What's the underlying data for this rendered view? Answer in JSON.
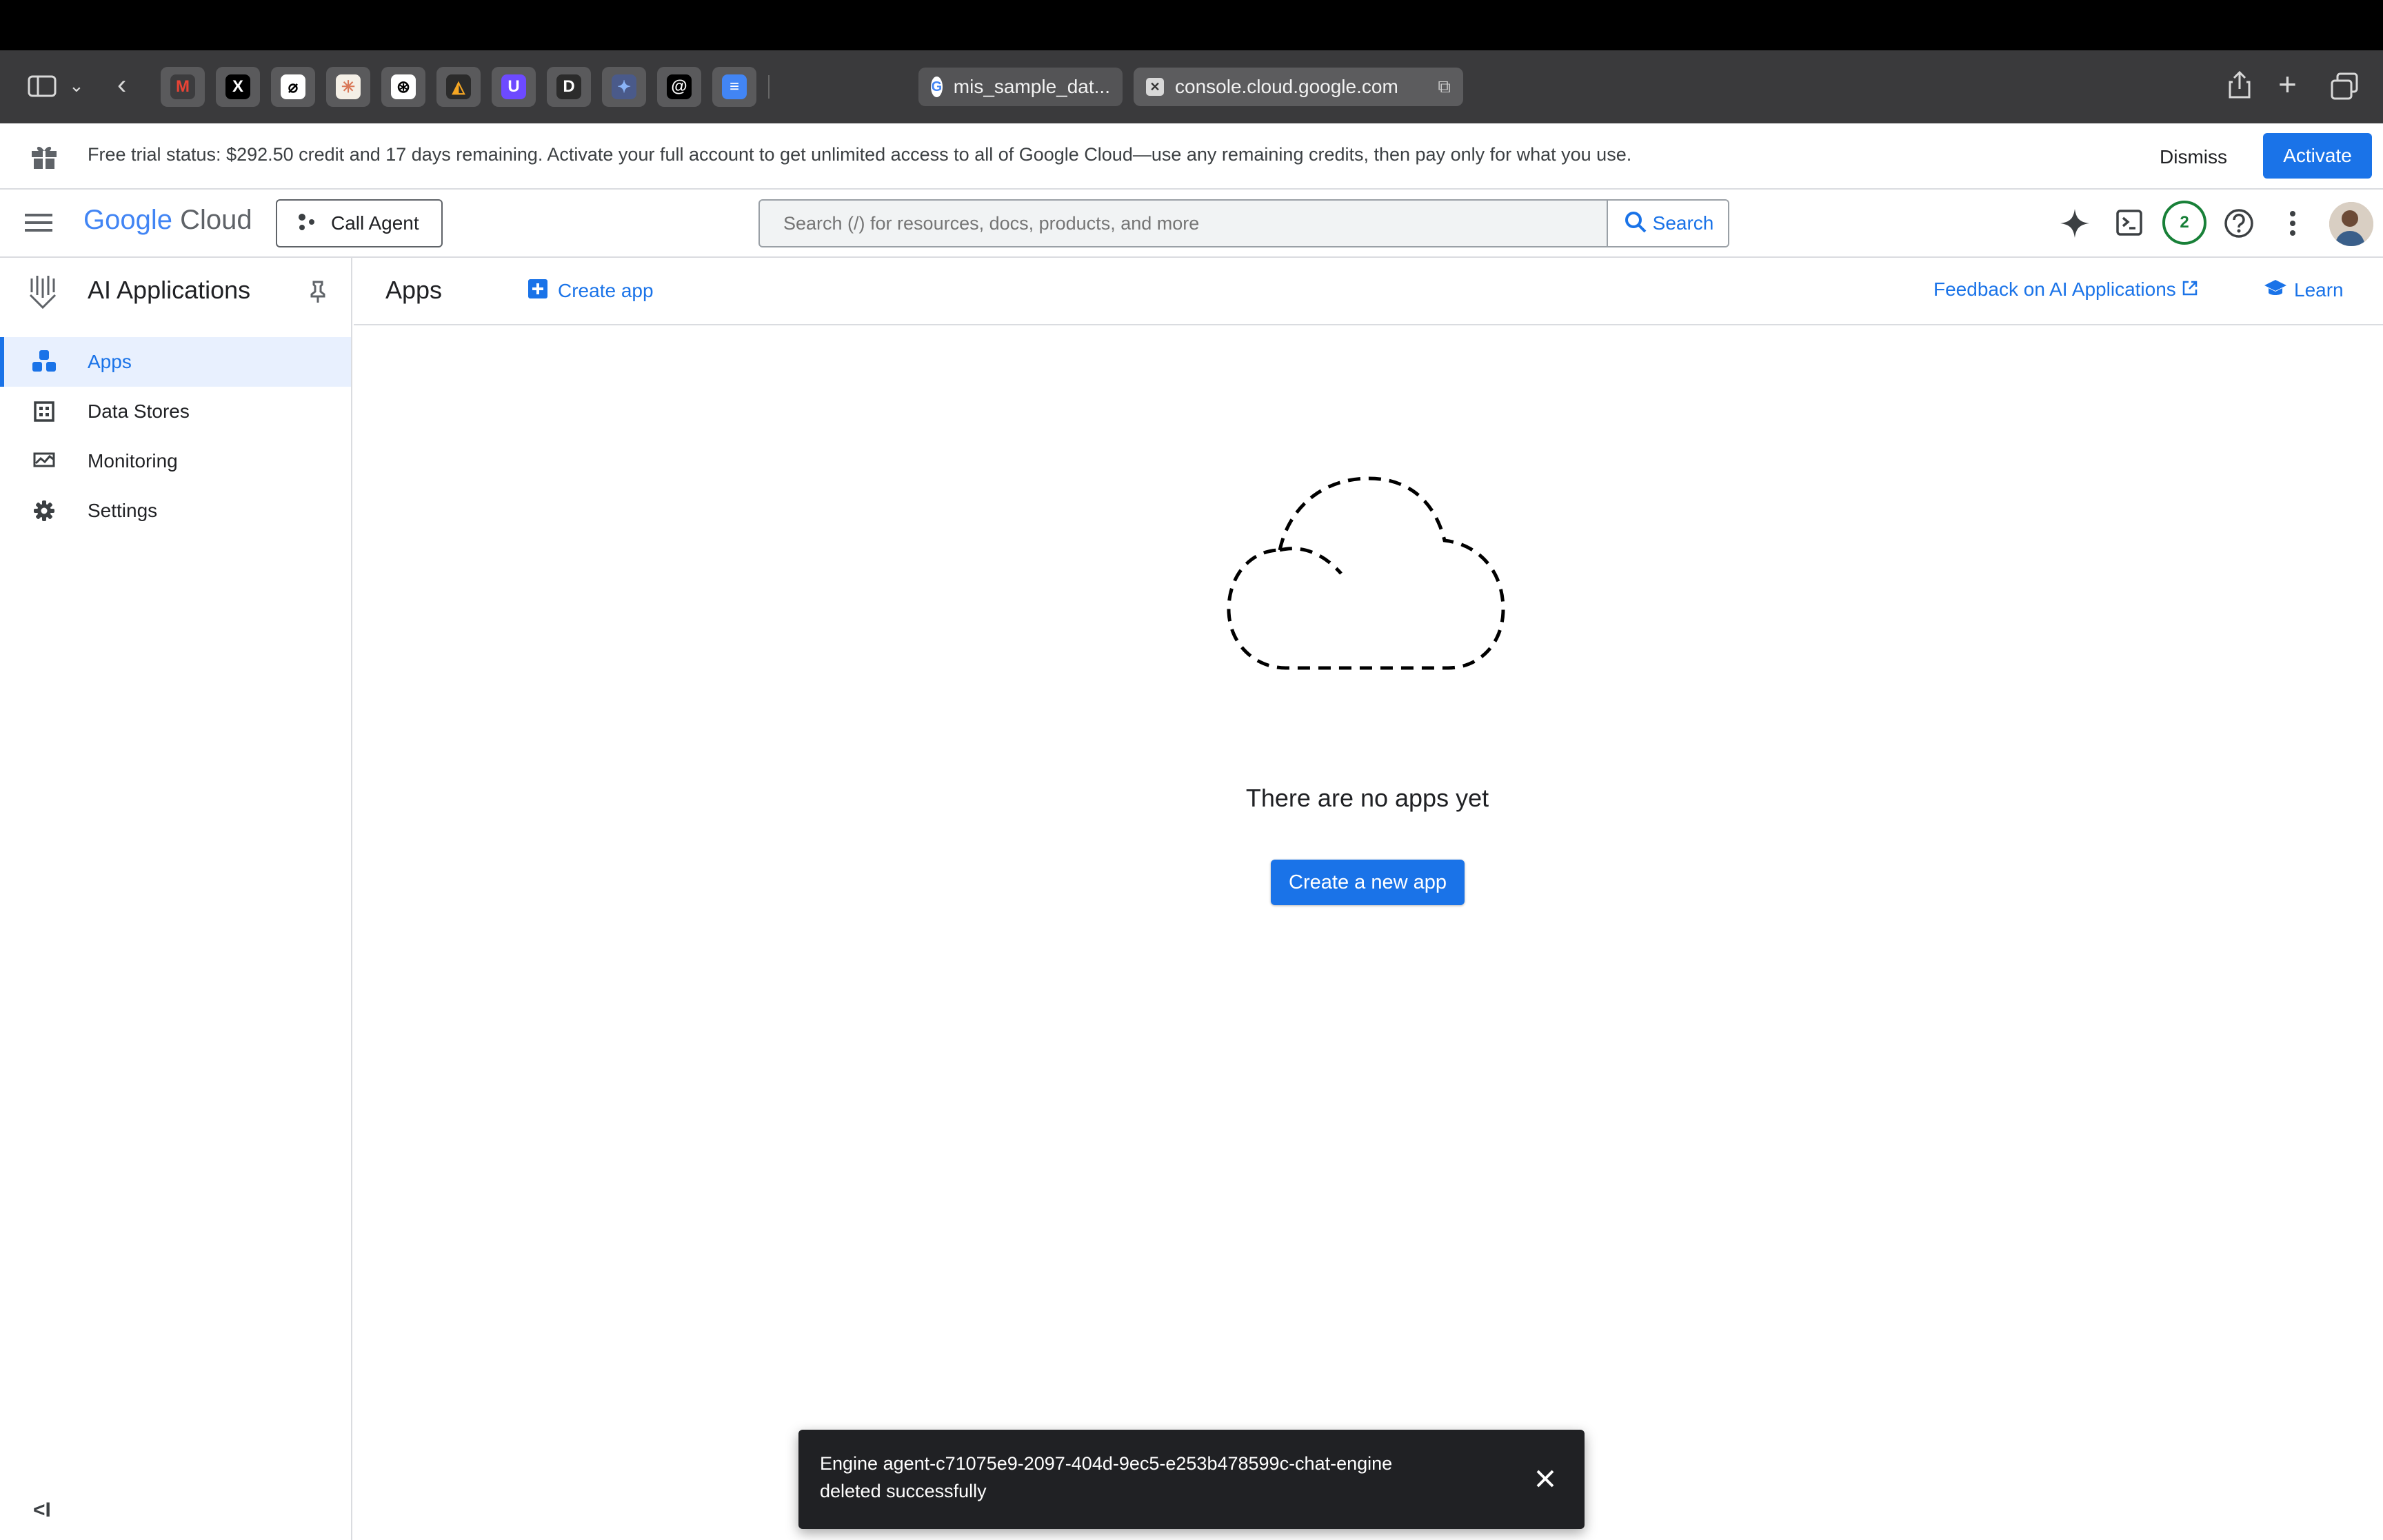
{
  "browser": {
    "tabs": [
      {
        "title": "mis_sample_dat...",
        "favicon": "google-g-icon"
      },
      {
        "title": "console.cloud.google.com",
        "favicon": "close-icon"
      }
    ],
    "favorites": [
      {
        "name": "gmail-favicon",
        "bg": "#3c3c3e",
        "glyph": "M",
        "color": "#ea4335"
      },
      {
        "name": "x-favicon",
        "bg": "#000000",
        "glyph": "X",
        "color": "#ffffff"
      },
      {
        "name": "perplexity-favicon",
        "bg": "#ffffff",
        "glyph": "⌀",
        "color": "#000000"
      },
      {
        "name": "claude-favicon",
        "bg": "#f4efe6",
        "glyph": "✳",
        "color": "#d97757"
      },
      {
        "name": "openai-favicon",
        "bg": "#ffffff",
        "glyph": "⊛",
        "color": "#000000"
      },
      {
        "name": "app-favicon",
        "bg": "#2b2b2b",
        "glyph": "◭",
        "color": "#f5a623"
      },
      {
        "name": "proton-favicon",
        "bg": "#6d4aff",
        "glyph": "U",
        "color": "#ffffff"
      },
      {
        "name": "d-favicon",
        "bg": "#2b2b2b",
        "glyph": "D",
        "color": "#ffffff"
      },
      {
        "name": "gemini-favicon",
        "bg": "#4a5a8a",
        "glyph": "✦",
        "color": "#8ab4f8"
      },
      {
        "name": "threads-favicon",
        "bg": "#000000",
        "glyph": "@",
        "color": "#ffffff"
      },
      {
        "name": "docs-favicon",
        "bg": "#4285f4",
        "glyph": "≡",
        "color": "#ffffff"
      }
    ]
  },
  "banner": {
    "text": "Free trial status: $292.50 credit and 17 days remaining. Activate your full account to get unlimited access to all of Google Cloud—use any remaining credits, then pay only for what you use.",
    "dismiss": "Dismiss",
    "activate": "Activate"
  },
  "header": {
    "logo_google": "Google",
    "logo_cloud": "Cloud",
    "call_agent": "Call Agent",
    "search_placeholder": "Search (/) for resources, docs, products, and more",
    "search_button": "Search",
    "notifications_count": "2"
  },
  "product": {
    "title": "AI Applications"
  },
  "nav": {
    "items": [
      {
        "label": "Apps",
        "icon": "apps-icon",
        "active": true
      },
      {
        "label": "Data Stores",
        "icon": "data-stores-icon",
        "active": false
      },
      {
        "label": "Monitoring",
        "icon": "monitoring-icon",
        "active": false
      },
      {
        "label": "Settings",
        "icon": "gear-icon",
        "active": false
      }
    ]
  },
  "page": {
    "title": "Apps",
    "create_app": "Create app",
    "feedback": "Feedback on AI Applications",
    "learn": "Learn"
  },
  "empty_state": {
    "message": "There are no apps yet",
    "button": "Create a new app"
  },
  "toast": {
    "line1": "Engine agent-c71075e9-2097-404d-9ec5-e253b478599c-chat-engine",
    "line2": "deleted successfully"
  },
  "colors": {
    "accent": "#1a73e8",
    "notification_ring": "#188038"
  }
}
